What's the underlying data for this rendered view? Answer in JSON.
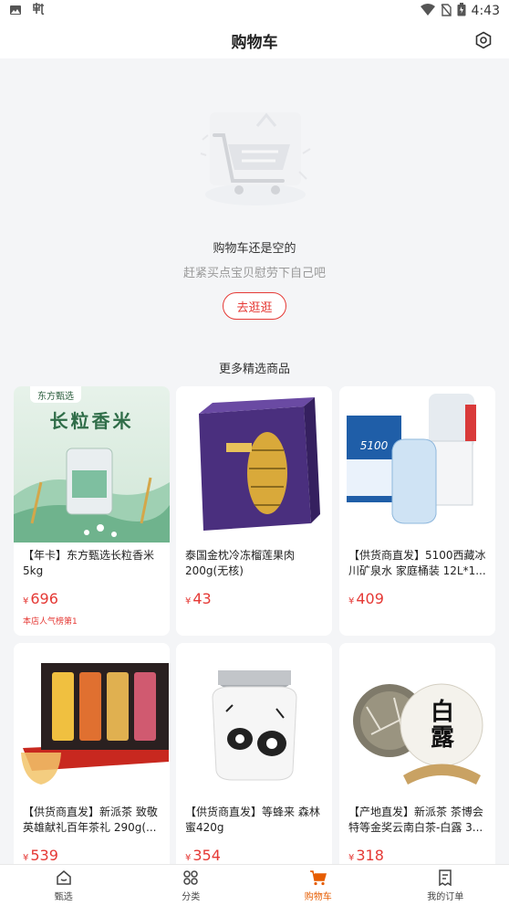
{
  "status_bar": {
    "time": "4:43"
  },
  "header": {
    "title": "购物车"
  },
  "empty_cart": {
    "title": "购物车还是空的",
    "subtitle": "赶紧买点宝贝慰劳下自己吧",
    "shop_button": "去逛逛"
  },
  "section": {
    "title": "更多精选商品"
  },
  "products": [
    {
      "name": "【年卡】东方甄选长粒香米5kg",
      "currency": "¥",
      "price": "696",
      "tag": "本店人气榜第1",
      "image_text": "长粒香米",
      "brand": "东方甄选"
    },
    {
      "name": "泰国金枕冷冻榴莲果肉200g(无核)",
      "currency": "¥",
      "price": "43",
      "tag": ""
    },
    {
      "name": "【供货商直发】5100西藏冰川矿泉水 家庭桶装 12L*1...",
      "currency": "¥",
      "price": "409",
      "tag": "",
      "image_text": "5100"
    },
    {
      "name": "【供货商直发】新派茶 致敬英雄献礼百年茶礼 290g(...",
      "currency": "¥",
      "price": "539",
      "tag": ""
    },
    {
      "name": "【供货商直发】等蜂来 森林蜜420g",
      "currency": "¥",
      "price": "354",
      "tag": ""
    },
    {
      "name": "【产地直发】新派茶 茶博会特等金奖云南白茶-白露 3...",
      "currency": "¥",
      "price": "318",
      "tag": "",
      "image_text": "白露"
    }
  ],
  "bottom_nav": [
    {
      "label": "甄选",
      "icon": "home-icon",
      "active": false
    },
    {
      "label": "分类",
      "icon": "category-icon",
      "active": false
    },
    {
      "label": "购物车",
      "icon": "cart-icon",
      "active": true
    },
    {
      "label": "我的订单",
      "icon": "orders-icon",
      "active": false
    }
  ],
  "colors": {
    "accent": "#e53935",
    "nav_active": "#e65c00"
  }
}
